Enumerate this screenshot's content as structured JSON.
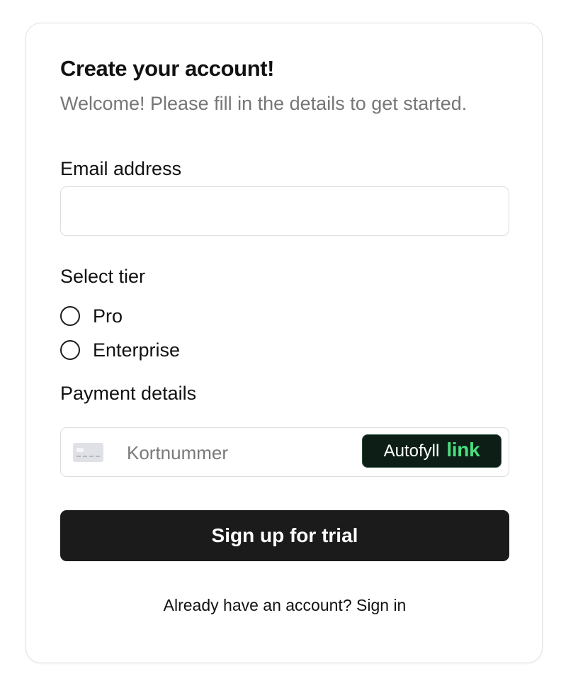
{
  "header": {
    "title": "Create your account!",
    "subtitle": "Welcome! Please fill in the details to get started."
  },
  "email": {
    "label": "Email address",
    "value": "",
    "placeholder": ""
  },
  "tier": {
    "label": "Select tier",
    "options": [
      {
        "label": "Pro",
        "selected": false
      },
      {
        "label": "Enterprise",
        "selected": false
      }
    ]
  },
  "payment": {
    "label": "Payment details",
    "card_icon": "credit-card-icon",
    "card_placeholder": "Kortnummer",
    "autofill": {
      "text": "Autofyll",
      "brand": "link",
      "brand_color": "#4ade80",
      "background": "#0c1e16"
    }
  },
  "submit": {
    "label": "Sign up for trial",
    "background": "#1b1b1b"
  },
  "footer": {
    "prompt": "Already have an account?",
    "link": "Sign in"
  }
}
